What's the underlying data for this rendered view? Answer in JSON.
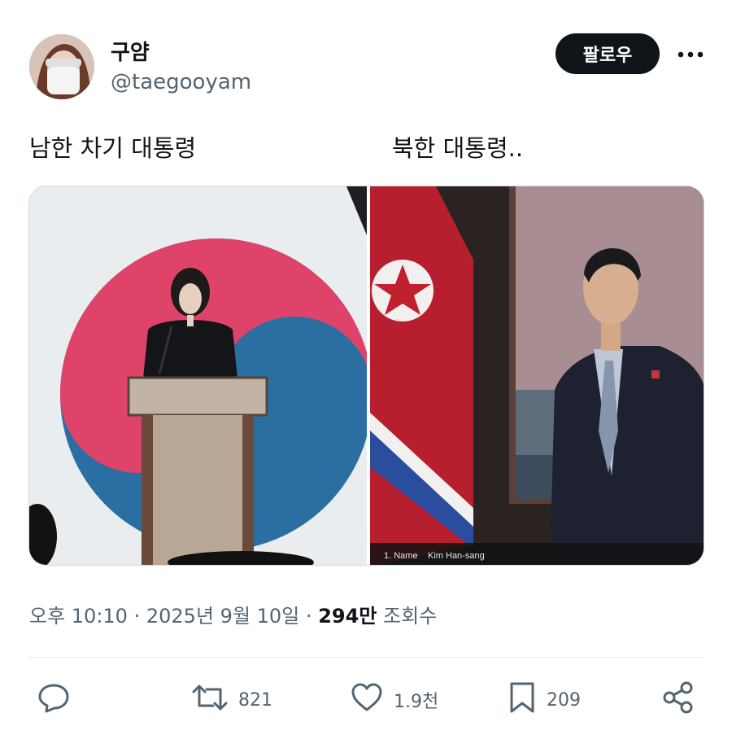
{
  "user": {
    "display_name": "구얌",
    "handle": "@taegooyam",
    "follow_label": "팔로우"
  },
  "tweet": {
    "text_left": "남한 차기 대통령",
    "text_right": "북한 대통령..",
    "caption_name_label": "1. Name",
    "caption_name_value": "Kim Han-sang"
  },
  "meta": {
    "time": "오후 10:10",
    "date": "2025년 9월 10일",
    "separator": "·",
    "views_count": "294만",
    "views_label": "조회수"
  },
  "actions": {
    "replies": "",
    "retweets": "821",
    "likes": "1.9천",
    "bookmarks": "209"
  },
  "colors": {
    "text_primary": "#0f1419",
    "text_secondary": "#536471",
    "divider": "#e7e9ea",
    "follow_bg": "#0f1419"
  },
  "icons": [
    "more-icon",
    "reply-icon",
    "retweet-icon",
    "like-icon",
    "bookmark-icon",
    "share-icon"
  ]
}
